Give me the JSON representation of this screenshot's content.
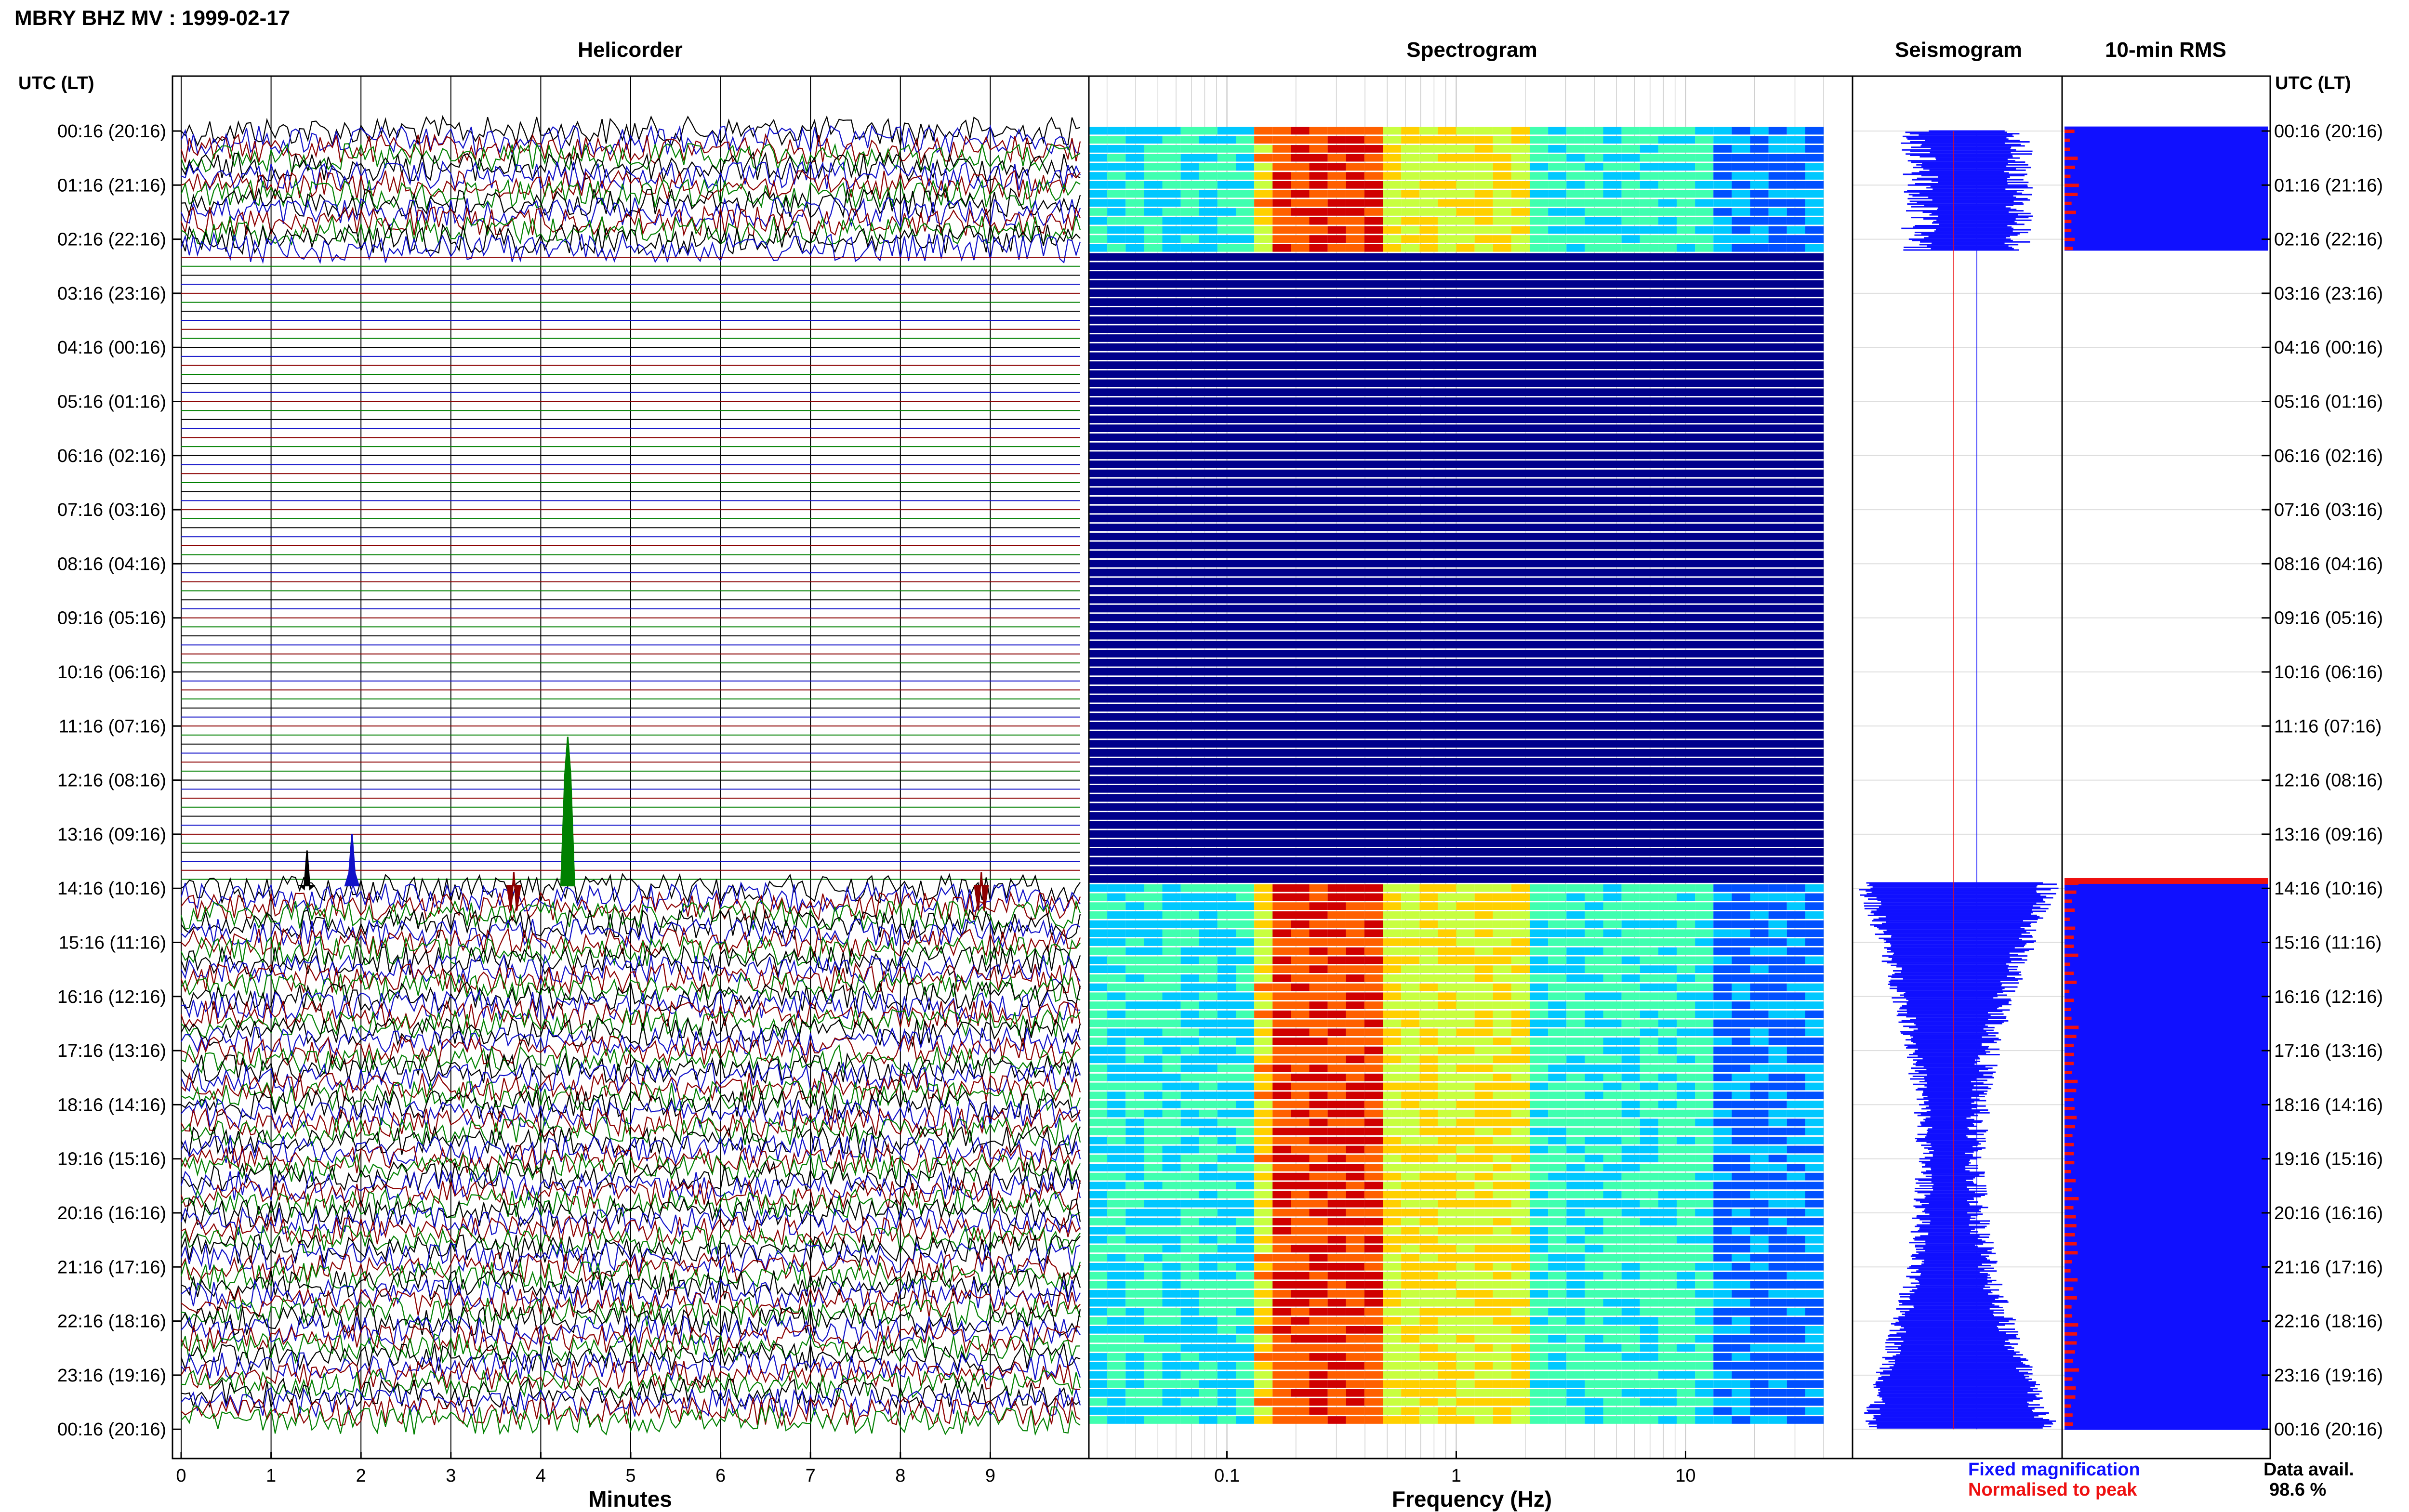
{
  "header": {
    "title": "MBRY BHZ MV : 1999-02-17",
    "tz_label_left": "UTC (LT)",
    "tz_label_right": "UTC (LT)"
  },
  "panels": {
    "helicorder": "Helicorder",
    "spectrogram": "Spectrogram",
    "seismogram": "Seismogram",
    "rms": "10-min RMS"
  },
  "time_labels": [
    "00:16 (20:16)",
    "01:16 (21:16)",
    "02:16 (22:16)",
    "03:16 (23:16)",
    "04:16 (00:16)",
    "05:16 (01:16)",
    "06:16 (02:16)",
    "07:16 (03:16)",
    "08:16 (04:16)",
    "09:16 (05:16)",
    "10:16 (06:16)",
    "11:16 (07:16)",
    "12:16 (08:16)",
    "13:16 (09:16)",
    "14:16 (10:16)",
    "15:16 (11:16)",
    "16:16 (12:16)",
    "17:16 (13:16)",
    "18:16 (14:16)",
    "19:16 (15:16)",
    "20:16 (16:16)",
    "21:16 (17:16)",
    "22:16 (18:16)",
    "23:16 (19:16)",
    "00:16 (20:16)"
  ],
  "legend": {
    "fixed": "Fixed magnification",
    "normalised": "Normalised to peak",
    "fixed_color": "#1010ff",
    "normalised_color": "#ee1010"
  },
  "availability": {
    "label": "Data avail.",
    "value": "98.6 %"
  },
  "chart_data": [
    {
      "type": "line",
      "name": "helicorder",
      "xlabel": "Minutes",
      "x_ticks": [
        "0",
        "1",
        "2",
        "3",
        "4",
        "5",
        "6",
        "7",
        "8",
        "9"
      ],
      "xlim": [
        0,
        10
      ],
      "trace_colors": [
        "#000000",
        "#1010c8",
        "#8b0000",
        "#008000"
      ],
      "data_segments_hours": [
        [
          0,
          2.2
        ],
        [
          13.9,
          24
        ]
      ],
      "events": [
        {
          "minute": 1.4,
          "hour": 13.3,
          "color": "#000000"
        },
        {
          "minute": 1.9,
          "hour": 13.0,
          "color": "#1010c8"
        },
        {
          "minute": 4.3,
          "hour": 11.2,
          "color": "#008000"
        },
        {
          "minute": 3.7,
          "hour": 13.7,
          "color": "#8b0000"
        },
        {
          "minute": 8.9,
          "hour": 13.7,
          "color": "#8b0000"
        }
      ]
    },
    {
      "type": "heatmap",
      "name": "spectrogram",
      "xlabel": "Frequency (Hz)",
      "x_scale": "log",
      "x_ticks": [
        "0.1",
        "1",
        "10"
      ],
      "xlim": [
        0.025,
        40
      ],
      "data_segments_hours": [
        [
          0,
          2.2
        ],
        [
          13.9,
          24
        ]
      ],
      "peak_band_hz": [
        0.15,
        0.45
      ],
      "colormap": [
        "#00008b",
        "#0050ff",
        "#00c8ff",
        "#40ffb0",
        "#c8ff40",
        "#ffd000",
        "#ff6000",
        "#d00000"
      ]
    },
    {
      "type": "bar",
      "name": "seismogram",
      "data_segments_hours": [
        [
          0,
          2.2
        ],
        [
          13.9,
          24
        ]
      ],
      "fixed_color": "#1010ff",
      "normalised_color": "#ee1010"
    },
    {
      "type": "bar",
      "name": "rms",
      "data_segments_hours": [
        [
          0,
          2.2
        ],
        [
          13.9,
          24
        ]
      ],
      "bar_color": "#1010ff",
      "marker_color": "#ee1010"
    }
  ]
}
